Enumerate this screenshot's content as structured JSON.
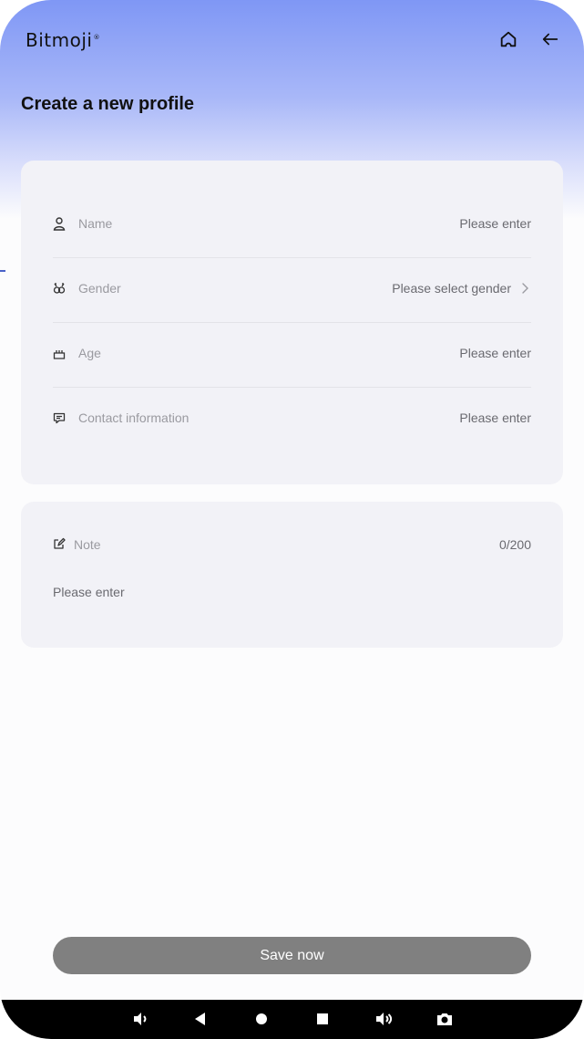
{
  "header": {
    "logo": "Bitmoji",
    "logo_mark": "®",
    "home_icon": "home-icon",
    "back_icon": "back-arrow-icon"
  },
  "page": {
    "title": "Create a new profile"
  },
  "fields": [
    {
      "icon": "person-icon",
      "label": "Name",
      "value": "Please enter"
    },
    {
      "icon": "gender-icon",
      "label": "Gender",
      "value": "Please select gender",
      "chevron": "chevron-right-icon"
    },
    {
      "icon": "cake-icon",
      "label": "Age",
      "value": "Please enter"
    },
    {
      "icon": "chat-icon",
      "label": "Contact information",
      "value": "Please enter"
    }
  ],
  "note": {
    "icon": "edit-icon",
    "label": "Note",
    "count": "0/200",
    "placeholder": "Please enter"
  },
  "actions": {
    "save_label": "Save now",
    "save_color": "#808080"
  },
  "nav_bar": {
    "buttons": [
      "volume-down-icon",
      "back-triangle-icon",
      "home-circle-icon",
      "recents-square-icon",
      "volume-up-icon",
      "camera-icon"
    ]
  },
  "colors": {
    "gradient_top": "#7f97f5",
    "card_bg": "#f2f2f7",
    "background": "#fcfcfd"
  }
}
